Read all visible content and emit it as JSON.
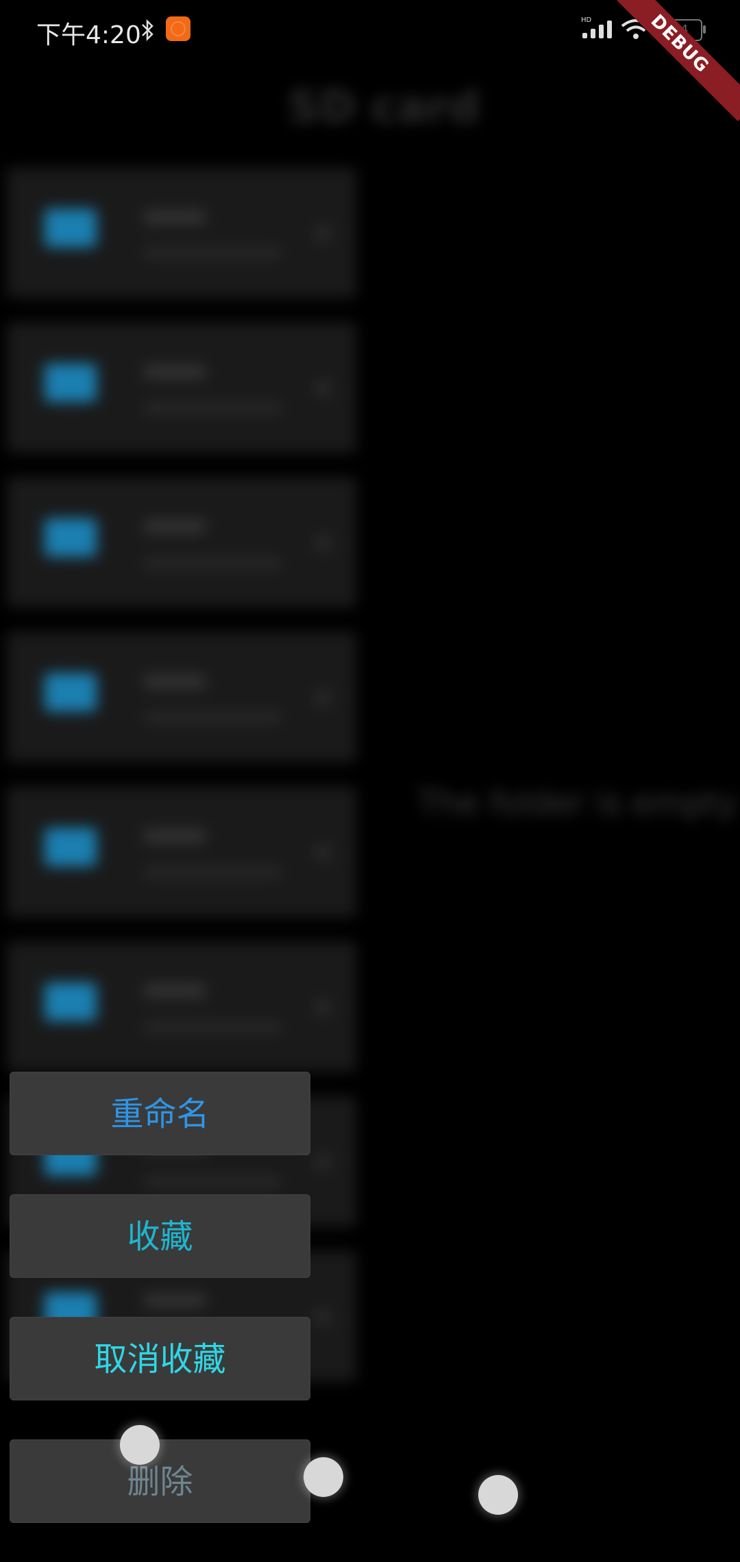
{
  "status_bar": {
    "time": "下午4:20",
    "battery_level": "64",
    "debug_label": "DEBUG",
    "icons": [
      "bluetooth-icon",
      "app-badge-icon",
      "signal-icon",
      "wifi-icon",
      "battery-icon"
    ]
  },
  "background": {
    "title": "SD card",
    "empty_message": "The folder is empty"
  },
  "menu": {
    "rename": "重命名",
    "favorite": "收藏",
    "unfavorite": "取消收藏",
    "delete": "删除"
  },
  "colors": {
    "rename": "#2f95e6",
    "favorite": "#1fb5cf",
    "unfavorite": "#2fd7e6",
    "delete": "#6f8590",
    "menu_bg": "#3a3a3a",
    "folder": "#1b7fb0",
    "debug_ribbon": "#8b1d24"
  }
}
